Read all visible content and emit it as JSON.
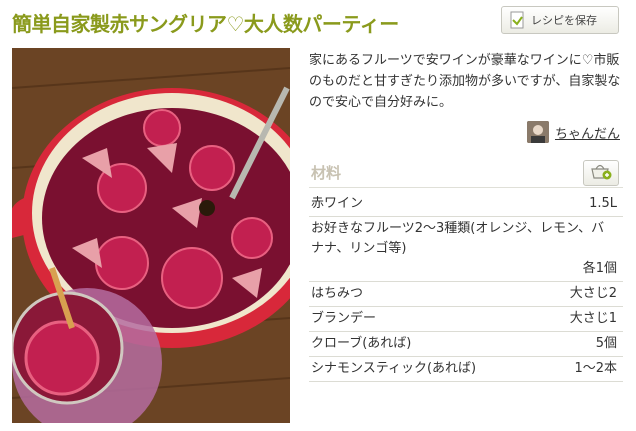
{
  "recipe": {
    "title": "簡単自家製赤サングリア♡大人数パーティー",
    "save_label": "レシピを保存",
    "description": "家にあるフルーツで安ワインが豪華なワインに♡市販のものだと甘すぎたり添加物が多いですが、自家製なので安心で自分好みに。",
    "author": "ちゃんだん"
  },
  "ingredients": {
    "heading": "材料",
    "items": [
      {
        "name": "赤ワイン",
        "qty": "1.5L"
      },
      {
        "name": "お好きなフルーツ2〜3種類(オレンジ、レモン、バナナ、リンゴ等)",
        "qty": "各1個"
      },
      {
        "name": "はちみつ",
        "qty": "大さじ2"
      },
      {
        "name": "ブランデー",
        "qty": "大さじ1"
      },
      {
        "name": "クローブ(あれば)",
        "qty": "5個"
      },
      {
        "name": "シナモンスティック(あれば)",
        "qty": "1〜2本"
      }
    ]
  },
  "colors": {
    "title": "#8a9a1c",
    "heading": "#c8c2b2",
    "wine": "#7a1030",
    "pot": "#d8283a"
  },
  "icons": {
    "save": "bookmark-page-icon",
    "basket": "shopping-basket-add-icon"
  }
}
